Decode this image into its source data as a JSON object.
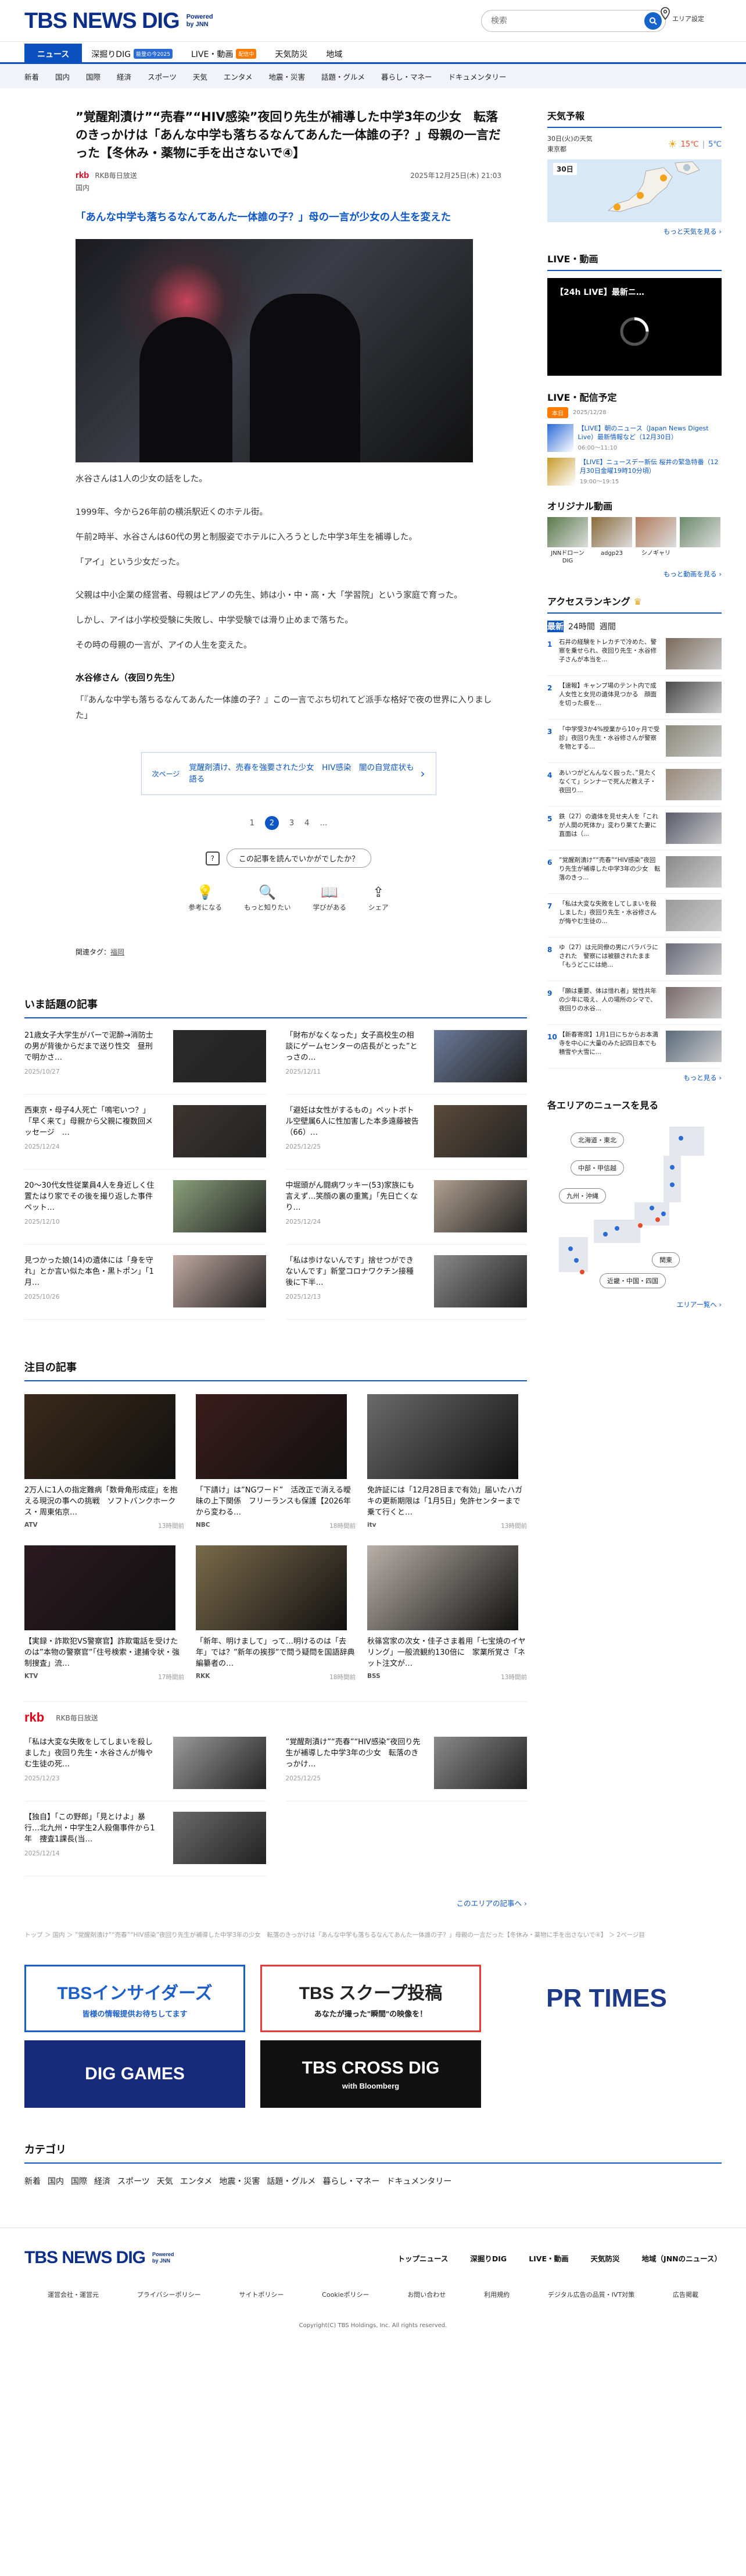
{
  "header": {
    "logo": "TBS NEWS DIG",
    "powered_line1": "Powered",
    "powered_line2": "by JNN",
    "search_placeholder": "検索",
    "area_label": "エリア設定"
  },
  "global_nav": [
    {
      "label": "ニュース",
      "active": true
    },
    {
      "label": "深掘りDIG",
      "badge": "能登の今2025",
      "badge_color": "#2a6bd6"
    },
    {
      "label": "LIVE・動画",
      "badge": "配信中",
      "badge_color": "#ff7a00"
    },
    {
      "label": "天気防災"
    },
    {
      "label": "地域"
    }
  ],
  "category_bar": [
    "新着",
    "国内",
    "国際",
    "経済",
    "スポーツ",
    "天気",
    "エンタメ",
    "地震・災害",
    "話題・グルメ",
    "暮らし・マネー",
    "ドキュメンタリー"
  ],
  "article": {
    "title": "”覚醒剤漬け”“売春”“HIV感染”夜回り先生が補導した中学3年の少女　転落のきっかけは「あんな中学も落ちるなんてあんた一体誰の子？」母親の一言だった【冬休み・薬物に手を出さないで④】",
    "source_logo": "rkb",
    "source": "RKB毎日放送",
    "date": "2025年12月25日(木) 21:03",
    "category": "国内",
    "lead": "「あんな中学も落ちるなんてあんた一体誰の子？」母の一言が少女の人生を変えた",
    "paragraphs": [
      {
        "text": "水谷さんは1人の少女の話をした。",
        "gap": false
      },
      {
        "text": "1999年、今から26年前の横浜駅近くのホテル街。",
        "gap": true
      },
      {
        "text": "午前2時半、水谷さんは60代の男と制服姿でホテルに入ろうとした中学3年生を補導した。",
        "gap": false
      },
      {
        "text": "「アイ」という少女だった。",
        "gap": false
      },
      {
        "text": "父親は中小企業の経営者、母親はピアノの先生、姉は小・中・高・大「学習院」という家庭で育った。",
        "gap": true
      },
      {
        "text": "しかし、アイは小学校受験に失敗し、中学受験では滑り止めまで落ちた。",
        "gap": false
      },
      {
        "text": "その時の母親の一言が、アイの人生を変えた。",
        "gap": false
      }
    ],
    "speaker": "水谷修さん（夜回り先生）",
    "quote": "「『あんな中学も落ちるなんてあんた一体誰の子？』この一言でぶち切れてど派手な格好で夜の世界に入りました」",
    "next_page_label": "次ページ",
    "next_page_title": "覚醒剤漬け、売春を強要された少女　HIV感染　闇の自覚症状も語る",
    "pages": [
      "1",
      "2",
      "3",
      "4",
      "…"
    ],
    "current_page": "2",
    "feedback_q": "この記事を読んでいかがでしたか？",
    "reactions": [
      {
        "icon": "lightbulb-icon",
        "glyph": "💡",
        "label": "参考になる"
      },
      {
        "icon": "search-icon",
        "glyph": "🔍",
        "label": "もっと知りたい"
      },
      {
        "icon": "book-icon",
        "glyph": "📖",
        "label": "学びがある"
      },
      {
        "icon": "share-icon",
        "glyph": "⇪",
        "label": "シェア"
      }
    ],
    "related_tags_label": "関連タグ：",
    "related_tag": "福岡"
  },
  "hot_topics": {
    "title": "いま話題の記事",
    "items": [
      {
        "text": "21歳女子大学生がパーで泥酔→消防士の男が背後からだまで送り性交　昼刑で明かさ…",
        "date": "2025/10/27",
        "color": "#2a2a2a"
      },
      {
        "text": "「財布がなくなった」女子高校生の相談にゲームセンターの店長がとった”とっさの…",
        "date": "2025/12/11",
        "color": "#6b7a9a"
      },
      {
        "text": "西東京・母子4人死亡「鳴宅いつ？」「早く来て」母親から父親に複数回メッセージ　…",
        "date": "2025/12/24",
        "color": "#3b3430"
      },
      {
        "text": "「避妊は女性がするもの」ペットボトル空壁属6人に性加害した本多遠藤被告（66）…",
        "date": "2025/12/25",
        "color": "#5a4a3a"
      },
      {
        "text": "20〜30代女性従業員4人を身近しく住置たはり家でその後を撮り返した事件　ペット…",
        "date": "2025/12/10",
        "color": "#8aa07a"
      },
      {
        "text": "中堀頭がん闘病ワッキー(53)家族にも言えず…笑顔の裏の重篤」「先日亡くなり…",
        "date": "2025/12/24",
        "color": "#b0a090"
      },
      {
        "text": "見つかった娘(14)の遺体には「身を守れ」とか言い似た本色・黒トポン」「1月…",
        "date": "2025/10/26",
        "color": "#c0a8a0"
      },
      {
        "text": "「私は歩けないんです」捨せつができないんです」新堂コロナワクチン接種後に下半…",
        "date": "2025/12/13",
        "color": "#8a8a8a"
      }
    ]
  },
  "featured": {
    "title": "注目の記事",
    "items": [
      {
        "text": "2万人に1人の指定難病「数骨角形成症」を抱える現況の事への挑戦　ソフトバンクホークス・周東佑京…",
        "brand": "ATV",
        "date": "13時間前",
        "color": "#3a2a1a"
      },
      {
        "text": "「下請け」は”NGワード”　活改正で消える曖昧の上下関係　フリーランスも保護【2026年から変わる…",
        "brand": "NBC",
        "date": "18時間前",
        "color": "#3b1c1c"
      },
      {
        "text": "免許証には「12月28日まで有効」届いたハガキの更新期限は「1月5日」免許センターまで乗て行くと…",
        "brand": "itv",
        "date": "13時間前",
        "color": "#6a6a6a"
      },
      {
        "text": "【実録・詐欺犯VS警察官】詐欺電話を受けたのは”本物の警察官”「住号検索・逮捕令状・強制搜査」流…",
        "brand": "KTV",
        "date": "17時間前",
        "color": "#2a1a20"
      },
      {
        "text": "「新年、明けまして」って…明けるのは「去年」では？”新年の挨拶”で問う疑問を国語辞典編纂者の…",
        "brand": "RKK",
        "date": "18時間前",
        "color": "#7a6a4a"
      },
      {
        "text": "秋篠宮家の次女・佳子さま着用「七宝焼のイヤリング」一般流観約130倍に　家業所覚さ「ネット注文が…",
        "brand": "BSS",
        "date": "13時間前",
        "color": "#b8b0a8"
      }
    ]
  },
  "rkb": {
    "label": "RKB毎日放送",
    "items": [
      {
        "text": "「私は大変な失敗をしてしまいを殺しました」夜回り先生・水谷さんが悔やむ生徒の死…",
        "date": "2025/12/23",
        "color": "#9a9a9a"
      },
      {
        "text": "”覚醒剤漬け”“売春”“HIV感染”夜回り先生が補導した中学3年の少女　転落のきっかけ…",
        "date": "2025/12/25",
        "color": "#8a8a8a"
      },
      {
        "text": "【独自】「この野郎」「見とけよ」暴行…北九州・中学生2人殺傷事件から1年　捜査1課長(当…",
        "date": "2025/12/14",
        "color": "#6a6a6a"
      }
    ],
    "more": "このエリアの記事へ ›"
  },
  "breadcrumb": "トップ ＞ 国内 ＞ ”覚醒剤漬け”“売春”“HIV感染”夜回り先生が補導した中学3年の少女　転落のきっかけは「あんな中学も落ちるなんてあんた一体誰の子？」母親の一言だった【冬休み・薬物に手を出さないで④】 ＞ 2ページ目",
  "banners": [
    {
      "name": "tbs-insiders-banner",
      "line1": "TBSインサイダーズ",
      "line2": "皆様の情報提供お待ちしてます"
    },
    {
      "name": "tbs-scoop-banner",
      "line1": "TBS スクープ投稿",
      "line2": "あなたが撮った\"瞬間\"の映像を！"
    },
    {
      "name": "pr-times-banner",
      "line1": "PR TIMES",
      "line2": ""
    },
    {
      "name": "dig-games-banner",
      "line1": "DIG GAMES",
      "line2": ""
    },
    {
      "name": "tbs-cross-dig-banner",
      "line1": "TBS CROSS DIG",
      "line2": "with Bloomberg"
    }
  ],
  "categories_section": {
    "title": "カテゴリ",
    "items": [
      "新着",
      "国内",
      "国際",
      "経済",
      "スポーツ",
      "天気",
      "エンタメ",
      "地震・災害",
      "話題・グルメ",
      "暮らし・マネー",
      "ドキュメンタリー"
    ]
  },
  "footer": {
    "links": [
      "トップニュース",
      "深掘りDIG",
      "LIVE・動画",
      "天気防災",
      "地域（JNNのニュース）"
    ],
    "sublinks": [
      "運営会社・運営元",
      "プライバシーポリシー",
      "サイトポリシー",
      "Cookieポリシー",
      "お問い合わせ",
      "利用規約",
      "デジタル広告の品質・IVT対策",
      "広告掲載"
    ],
    "copyright": "Copyright(C) TBS Holdings, Inc. All rights reserved."
  },
  "sidebar": {
    "weather": {
      "title": "天気予報",
      "date": "30日(火)の天気",
      "region": "東京都",
      "high": "15℃",
      "low": "5℃",
      "map_date": "30日",
      "more": "もっと天気を見る ›"
    },
    "live": {
      "title": "LIVE・動画",
      "video_title": "【24h LIVE】最新ニ…"
    },
    "schedule": {
      "title": "LIVE・配信予定",
      "day_badge": "本日",
      "date": "2025/12/28",
      "items": [
        {
          "text": "【LIVE】朝のニュース（Japan News Digest Live）最新情報など（12月30日）",
          "time": "06:00〜11:10",
          "color": "#2a6bd6"
        },
        {
          "text": "【LIVE】ニュースデー新伝 桜井の緊急特番（12月30日金曜19時10分頃）",
          "time": "19:00〜19:15",
          "color": "#c89a2a"
        }
      ]
    },
    "original": {
      "title": "オリジナル動画",
      "items": [
        {
          "label": "JNNドローンDIG",
          "color": "#5a7a4a"
        },
        {
          "label": "adgp23",
          "color": "#8a6a3a"
        },
        {
          "label": "シノギャリ",
          "color": "#b07a5a"
        },
        {
          "label": "",
          "color": "#6a8a6a"
        }
      ],
      "more": "もっと動画を見る ›"
    },
    "ranking": {
      "title": "アクセスランキング",
      "tabs": [
        "最新",
        "24時間",
        "週間"
      ],
      "items": [
        {
          "text": "石井の経験をトレカチで冷めた、警察を乗せられ、夜回り先生・水谷修子さんが本当を...",
          "color": "#7a6a5a"
        },
        {
          "text": "【速報】キャンプ場のテント内で成人女性と女児の遺体見つかる　顔面を切った痕を...",
          "color": "#4a4a4a"
        },
        {
          "text": "「中学受3か4%授業から10ヶ月で受診」夜回り先生・水谷修さんが警察を物とする...",
          "color": "#8a8a7a"
        },
        {
          "text": "あいつがどんんなく殴った、”見たくなくて」シンナーで死んだ教え子・夜回り...",
          "color": "#9a8a7a"
        },
        {
          "text": "鉄（27）の遺体を見せ夫人を「これが人間の死体か」変わり果てた妻に直面は（...",
          "color": "#5a5a6a"
        },
        {
          "text": "”覚醒剤漬け”“売春”“HIV感染”夜回り先生が補導した中学3年の少女　転落のきっ...",
          "color": "#8a8a8a"
        },
        {
          "text": "「私は大変な失敗をしてしまいを殺しました」夜回り先生・水谷修さんが悔やむ生徒の...",
          "color": "#9a9a9a"
        },
        {
          "text": "ゆ（27）は元同僚の男にバラバラにされた　警察には被額されたまま「もうどこには絶...",
          "color": "#6a6a7a"
        },
        {
          "text": "「願は重要、体は惜れ者」覚性共年の少年に吸え、人の場所のシマで、夜回りの水谷...",
          "color": "#7a6a6a"
        },
        {
          "text": "【新春寄席】1月1日にちからお本満寺を中心に大量のみた記四日本でも積雪や大雪に...",
          "color": "#5a6a7a"
        }
      ],
      "more": "もっと見る ›"
    },
    "areas": {
      "title": "各エリアのニュースを見る",
      "buttons": [
        "北海道・東北",
        "中部・甲信越",
        "九州・沖縄",
        "関東",
        "近畿・中国・四国"
      ],
      "more": "エリア一覧へ ›"
    }
  }
}
